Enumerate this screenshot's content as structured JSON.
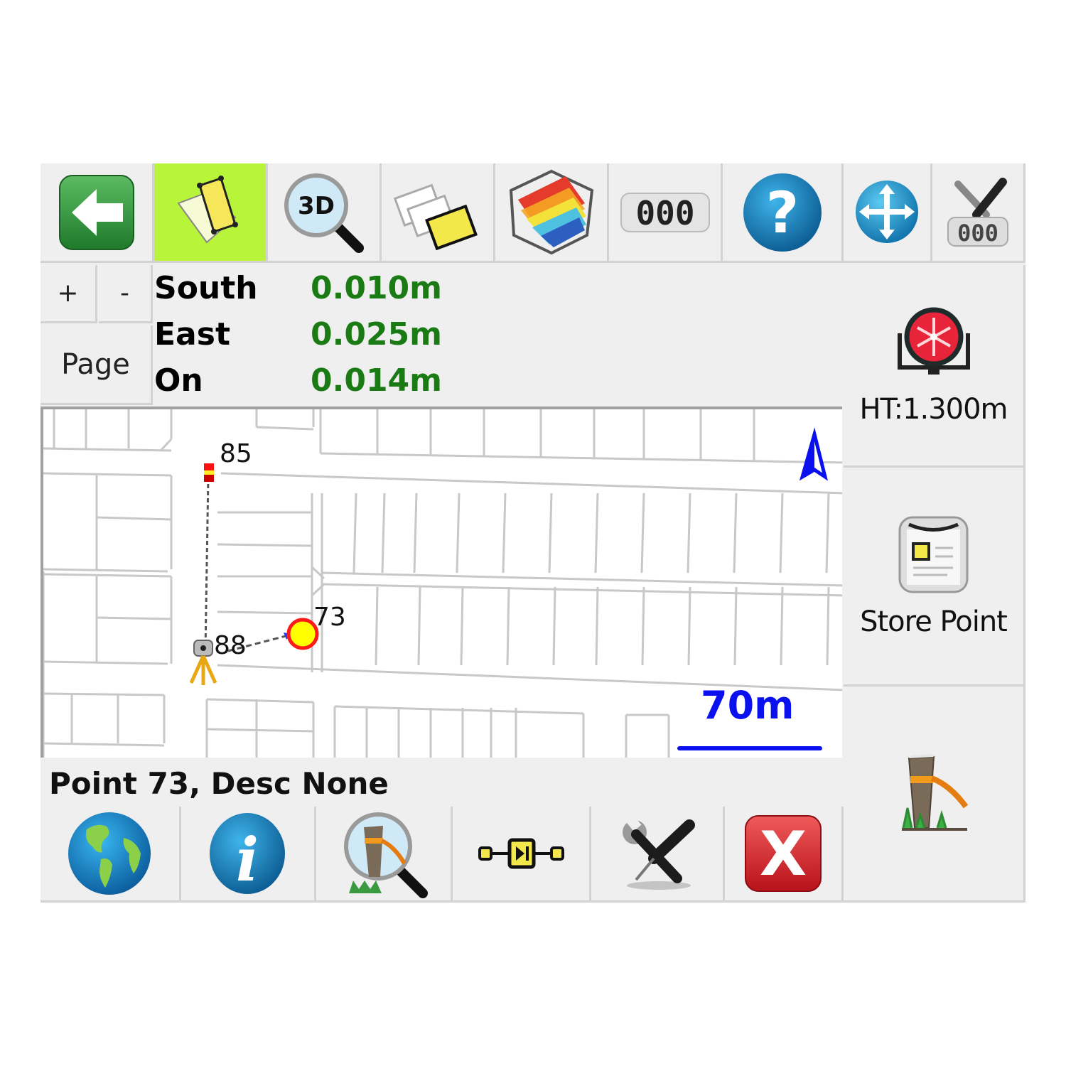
{
  "toolbar": {
    "buttons": [
      {
        "name": "back",
        "icon": "back-arrow-icon",
        "active": false
      },
      {
        "name": "map-view",
        "icon": "lot-plan-icon",
        "active": true
      },
      {
        "name": "3d-view",
        "icon": "3d-magnifier-icon",
        "label": "3D",
        "active": false
      },
      {
        "name": "layers",
        "icon": "layers-icon",
        "active": false
      },
      {
        "name": "surface",
        "icon": "surface-model-icon",
        "active": false
      },
      {
        "name": "counter",
        "icon": "counter-icon",
        "label": "000",
        "active": false
      },
      {
        "name": "help",
        "icon": "help-icon",
        "label": "?",
        "active": false
      },
      {
        "name": "pan",
        "icon": "pan-arrows-icon",
        "active": false
      },
      {
        "name": "instrument-settings",
        "icon": "tools-counter-icon",
        "active": false
      }
    ]
  },
  "zoom_controls": {
    "plus": "+",
    "minus": "-",
    "page": "Page"
  },
  "readout": {
    "rows": [
      {
        "label": "South",
        "value": "0.010m"
      },
      {
        "label": "East",
        "value": "0.025m"
      },
      {
        "label": "On",
        "value": "0.014m"
      }
    ]
  },
  "sidebar": {
    "target": {
      "icon": "prism-target-icon",
      "label": "HT:1.300m"
    },
    "store": {
      "icon": "store-point-icon",
      "label": "Store Point"
    },
    "stake": {
      "icon": "survey-stake-icon"
    }
  },
  "map": {
    "points": [
      {
        "id": "85",
        "type": "backsight"
      },
      {
        "id": "88",
        "type": "instrument-station"
      },
      {
        "id": "73",
        "type": "stake-target"
      }
    ],
    "scale_label": "70m",
    "north_arrow": "north-arrow-icon",
    "colors": {
      "scale": "#0a10ee",
      "target_fill": "#ffff00",
      "target_ring": "#ff1a1a",
      "lines": "#c8c8c8"
    }
  },
  "status": {
    "text": "Point 73, Desc None"
  },
  "bottombar": {
    "buttons": [
      {
        "name": "globe",
        "icon": "globe-icon"
      },
      {
        "name": "info",
        "icon": "info-icon",
        "label": "i"
      },
      {
        "name": "find-stake",
        "icon": "stake-search-icon"
      },
      {
        "name": "sequence",
        "icon": "sequence-play-icon"
      },
      {
        "name": "tools",
        "icon": "tools-icon"
      },
      {
        "name": "close",
        "icon": "close-icon",
        "label": "X"
      }
    ]
  },
  "colors": {
    "panel": "#efefef",
    "active_tab": "#b8f53a",
    "value_green": "#1a7a14"
  }
}
